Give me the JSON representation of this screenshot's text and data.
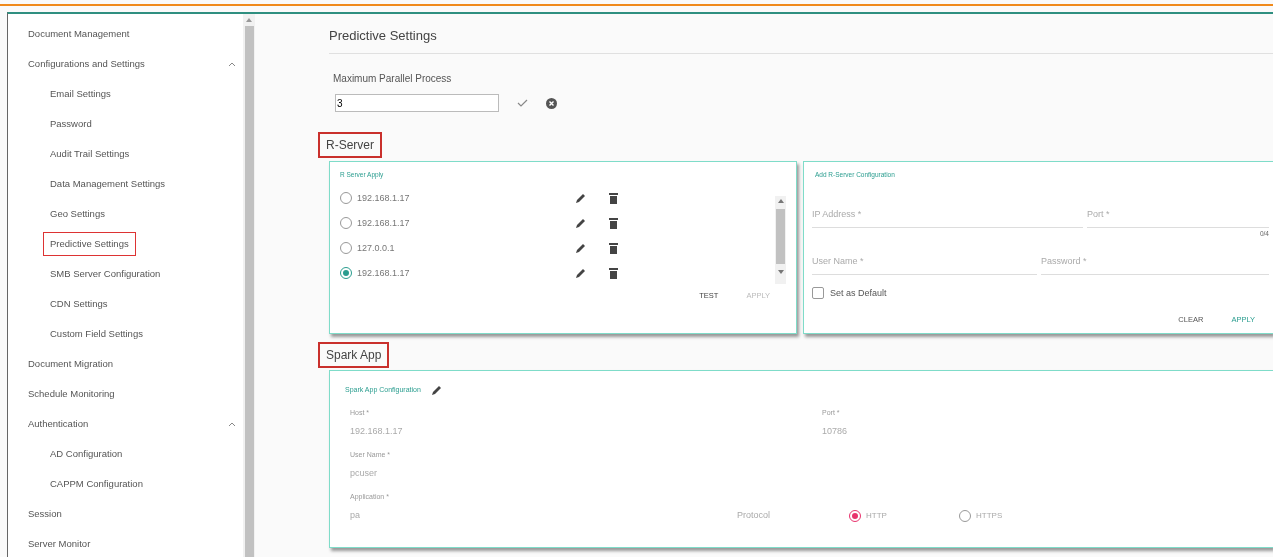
{
  "sidebar": {
    "items": [
      {
        "label": "Document Management",
        "selected": false
      },
      {
        "label": "Configurations and Settings",
        "selected": false,
        "expanded": true,
        "children": [
          {
            "label": "Email Settings",
            "selected": false
          },
          {
            "label": "Password",
            "selected": false
          },
          {
            "label": "Audit Trail Settings",
            "selected": false
          },
          {
            "label": "Data Management Settings",
            "selected": false
          },
          {
            "label": "Geo Settings",
            "selected": false
          },
          {
            "label": "Predictive Settings",
            "selected": true
          },
          {
            "label": "SMB Server Configuration",
            "selected": false
          },
          {
            "label": "CDN Settings",
            "selected": false
          },
          {
            "label": "Custom Field Settings",
            "selected": false
          }
        ]
      },
      {
        "label": "Document Migration",
        "selected": false
      },
      {
        "label": "Schedule Monitoring",
        "selected": false
      },
      {
        "label": "Authentication",
        "selected": false,
        "expanded": true,
        "children": [
          {
            "label": "AD Configuration",
            "selected": false
          },
          {
            "label": "CAPPM Configuration",
            "selected": false
          }
        ]
      },
      {
        "label": "Session",
        "selected": false
      },
      {
        "label": "Server Monitor",
        "selected": false
      }
    ]
  },
  "page": {
    "title": "Predictive Settings",
    "parallel": {
      "label": "Maximum Parallel Process",
      "value": "3"
    },
    "r_server": {
      "heading": "R-Server",
      "highlighted": true,
      "list": {
        "title": "R Server Apply",
        "servers": [
          {
            "address": "192.168.1.17",
            "selected": false
          },
          {
            "address": "192.168.1.17",
            "selected": false
          },
          {
            "address": "127.0.0.1",
            "selected": false
          },
          {
            "address": "192.168.1.17",
            "selected": true
          }
        ],
        "buttons": [
          {
            "label": "TEST",
            "disabled": false
          },
          {
            "label": "APPLY",
            "disabled": true
          }
        ]
      },
      "add": {
        "title": "Add R-Server Configuration",
        "ip_placeholder": "IP Address *",
        "port_placeholder": "Port *",
        "port_counter": "0/4",
        "user_placeholder": "User Name *",
        "password_placeholder": "Password *",
        "default_label": "Set as Default",
        "default_checked": false,
        "buttons": [
          {
            "label": "CLEAR",
            "kind": "plain"
          },
          {
            "label": "APPLY",
            "kind": "accent"
          }
        ]
      }
    },
    "spark": {
      "heading": "Spark App",
      "highlighted": true,
      "title": "Spark App Configuration",
      "host": {
        "label": "Host *",
        "value": "192.168.1.17"
      },
      "port": {
        "label": "Port *",
        "value": "10786"
      },
      "user": {
        "label": "User Name *",
        "value": "pcuser"
      },
      "app": {
        "label": "Application *",
        "value": "pa"
      },
      "protocol": {
        "label": "Protocol",
        "options": [
          {
            "label": "HTTP",
            "selected": true
          },
          {
            "label": "HTTPS",
            "selected": false
          }
        ]
      }
    }
  }
}
